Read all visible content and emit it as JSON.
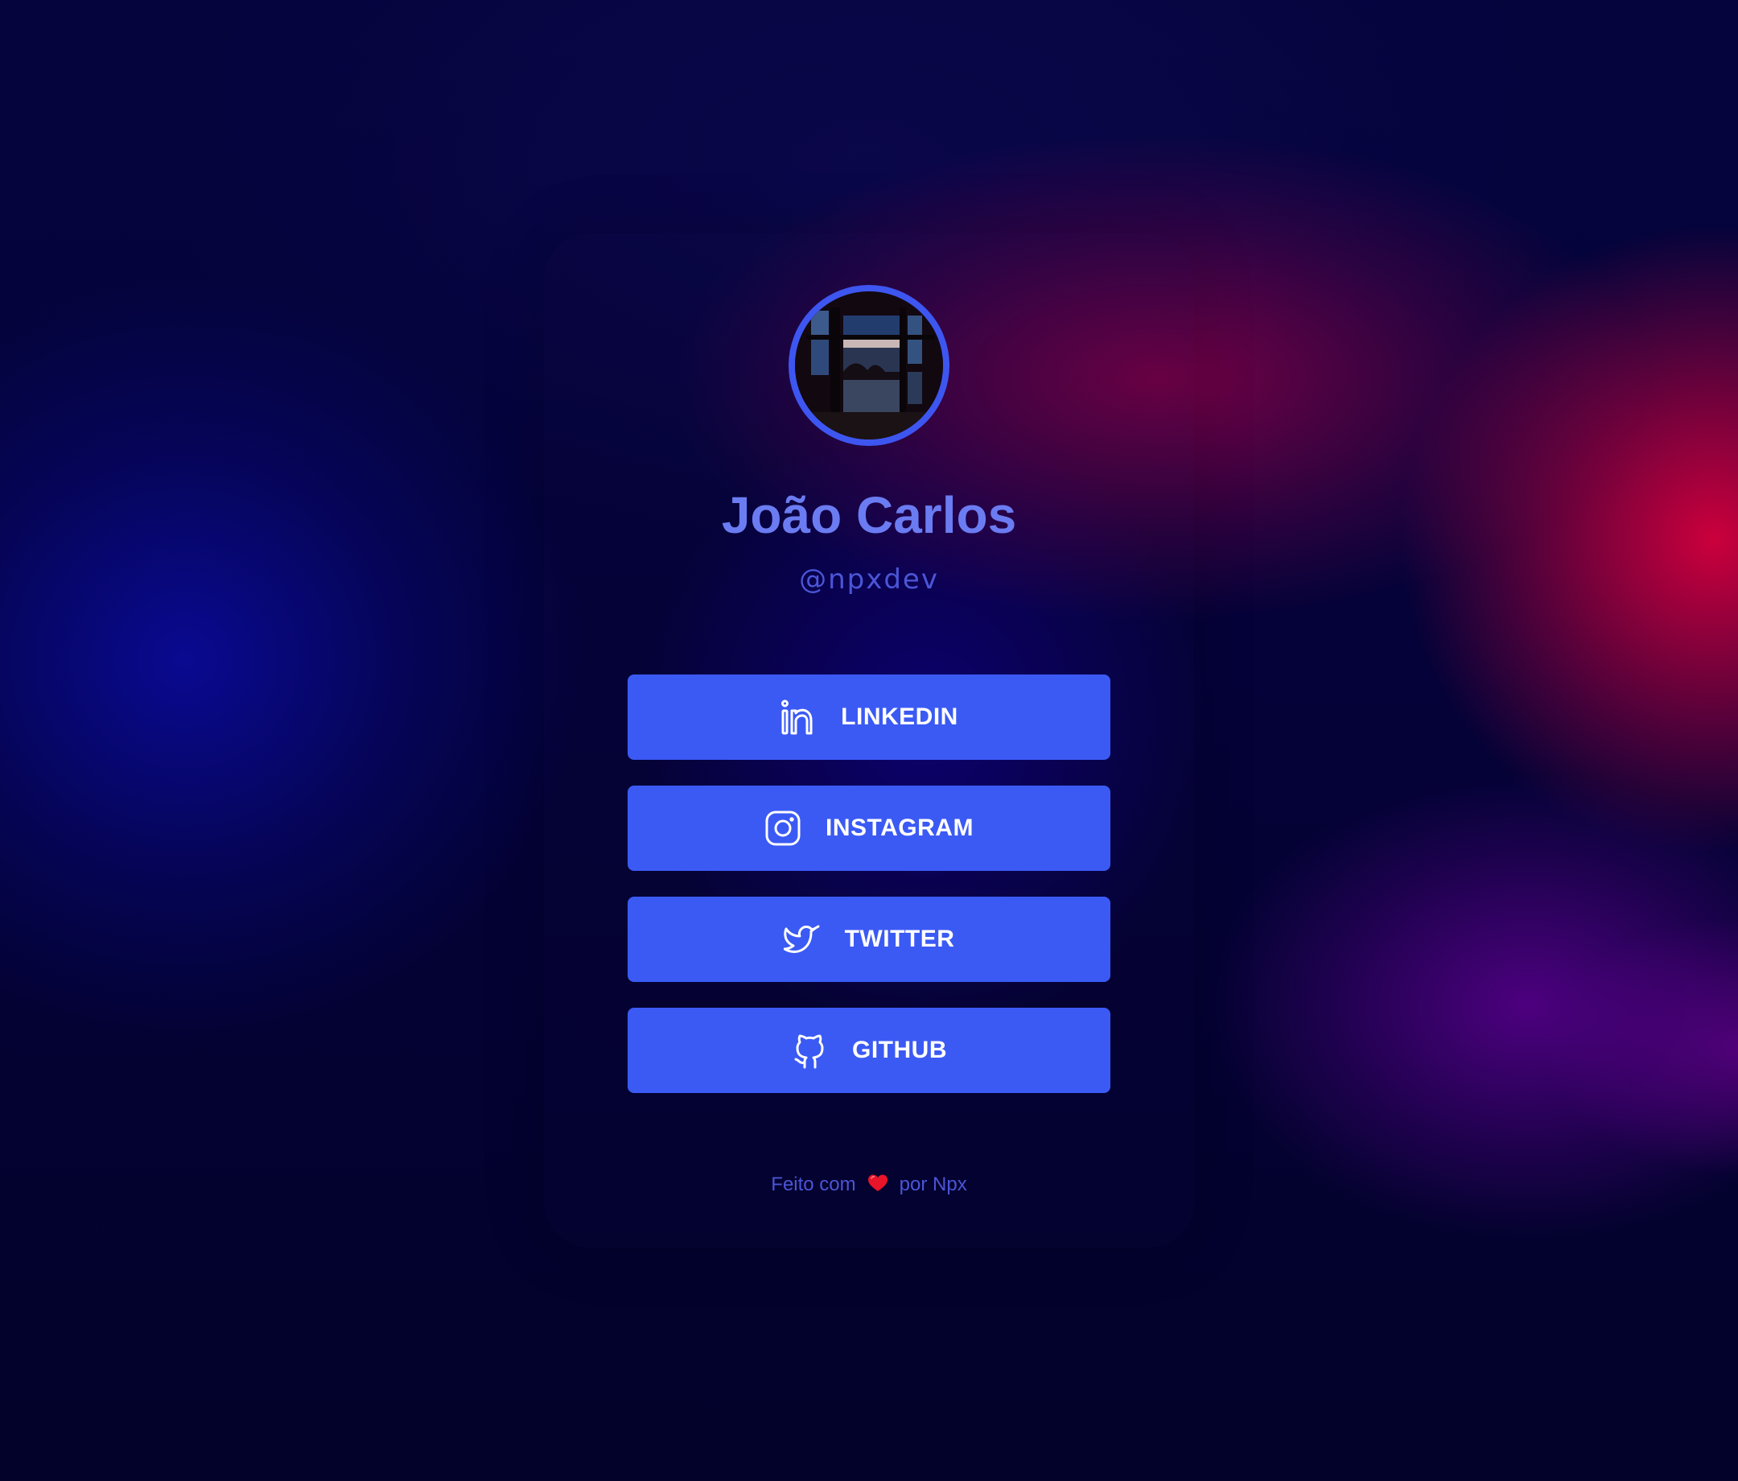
{
  "profile": {
    "name": "João Carlos",
    "handle": "@npxdev"
  },
  "links": [
    {
      "label": "LINKEDIN",
      "icon": "linkedin-icon"
    },
    {
      "label": "INSTAGRAM",
      "icon": "instagram-icon"
    },
    {
      "label": "TWITTER",
      "icon": "twitter-icon"
    },
    {
      "label": "GITHUB",
      "icon": "github-icon"
    }
  ],
  "footer": {
    "prefix": "Feito com",
    "heart_icon": "heart-icon",
    "suffix": "por Npx"
  },
  "colors": {
    "button": "#3b5af4",
    "name": "#6b7cf2",
    "handle": "#4b55d6",
    "avatar_ring": "#3e56f0",
    "heart": "#e8142a"
  }
}
